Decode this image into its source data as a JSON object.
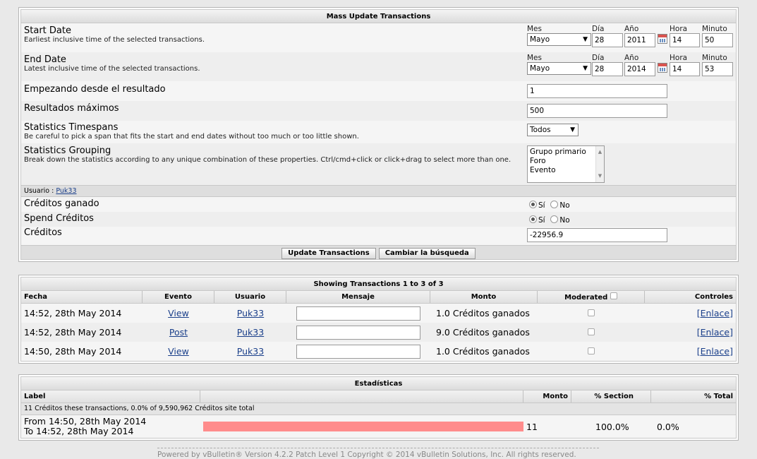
{
  "mass_update": {
    "title": "Mass Update Transactions",
    "start_date": {
      "label": "Start Date",
      "desc": "Earliest inclusive time of the selected transactions.",
      "mes_cap": "Mes",
      "dia_cap": "Día",
      "ano_cap": "Año",
      "hora_cap": "Hora",
      "minuto_cap": "Minuto",
      "mes": "Mayo",
      "dia": "28",
      "ano": "2011",
      "hora": "14",
      "minuto": "50"
    },
    "end_date": {
      "label": "End Date",
      "desc": "Latest inclusive time of the selected transactions.",
      "mes_cap": "Mes",
      "dia_cap": "Día",
      "ano_cap": "Año",
      "hora_cap": "Hora",
      "minuto_cap": "Minuto",
      "mes": "Mayo",
      "dia": "28",
      "ano": "2014",
      "hora": "14",
      "minuto": "53"
    },
    "start_result": {
      "label": "Empezando desde el resultado",
      "value": "1"
    },
    "max_results": {
      "label": "Resultados máximos",
      "value": "500"
    },
    "timespans": {
      "label": "Statistics Timespans",
      "desc": "Be careful to pick a span that fits the start and end dates without too much or too little shown.",
      "value": "Todos"
    },
    "grouping": {
      "label": "Statistics Grouping",
      "desc": "Break down the statistics according to any unique combination of these properties. Ctrl/cmd+click or click+drag to select more than one.",
      "options": [
        "Grupo primario",
        "Foro",
        "Evento"
      ]
    },
    "user_bar": {
      "prefix": "Usuario : ",
      "user": "Puk33"
    },
    "creditos_ganado": {
      "label": "Créditos ganado",
      "yes": "Sí",
      "no": "No"
    },
    "spend_creditos": {
      "label": "Spend Créditos",
      "yes": "Sí",
      "no": "No"
    },
    "creditos": {
      "label": "Créditos",
      "value": "-22956.9"
    },
    "update_button": "Update Transactions",
    "change_search_button": "Cambiar la búsqueda"
  },
  "transactions": {
    "title": "Showing Transactions 1 to 3 of 3",
    "headers": {
      "fecha": "Fecha",
      "evento": "Evento",
      "usuario": "Usuario",
      "mensaje": "Mensaje",
      "monto": "Monto",
      "moderated": "Moderated",
      "controles": "Controles"
    },
    "rows": [
      {
        "fecha": "14:52, 28th May 2014",
        "evento": "View",
        "usuario": "Puk33",
        "monto": "1.0 Créditos ganados",
        "control": "[Enlace]"
      },
      {
        "fecha": "14:52, 28th May 2014",
        "evento": "Post",
        "usuario": "Puk33",
        "monto": "9.0 Créditos ganados",
        "control": "[Enlace]"
      },
      {
        "fecha": "14:50, 28th May 2014",
        "evento": "View",
        "usuario": "Puk33",
        "monto": "1.0 Créditos ganados",
        "control": "[Enlace]"
      }
    ]
  },
  "stats": {
    "title": "Estadísticas",
    "headers": {
      "label": "Label",
      "monto": "Monto",
      "section": "% Section",
      "total": "% Total"
    },
    "summary": "11 Créditos these transactions, 0.0% of 9,590,962 Créditos site total",
    "row": {
      "from": "From 14:50, 28th May 2014",
      "to": "To 14:52, 28th May 2014",
      "monto": "11",
      "section": "100.0%",
      "total": "0.0%",
      "bar_fraction": 1.0,
      "bar_color": "#ff8c8c"
    }
  },
  "footer": "Powered by vBulletin® Version 4.2.2 Patch Level 1 Copyright © 2014 vBulletin Solutions, Inc. All rights reserved."
}
